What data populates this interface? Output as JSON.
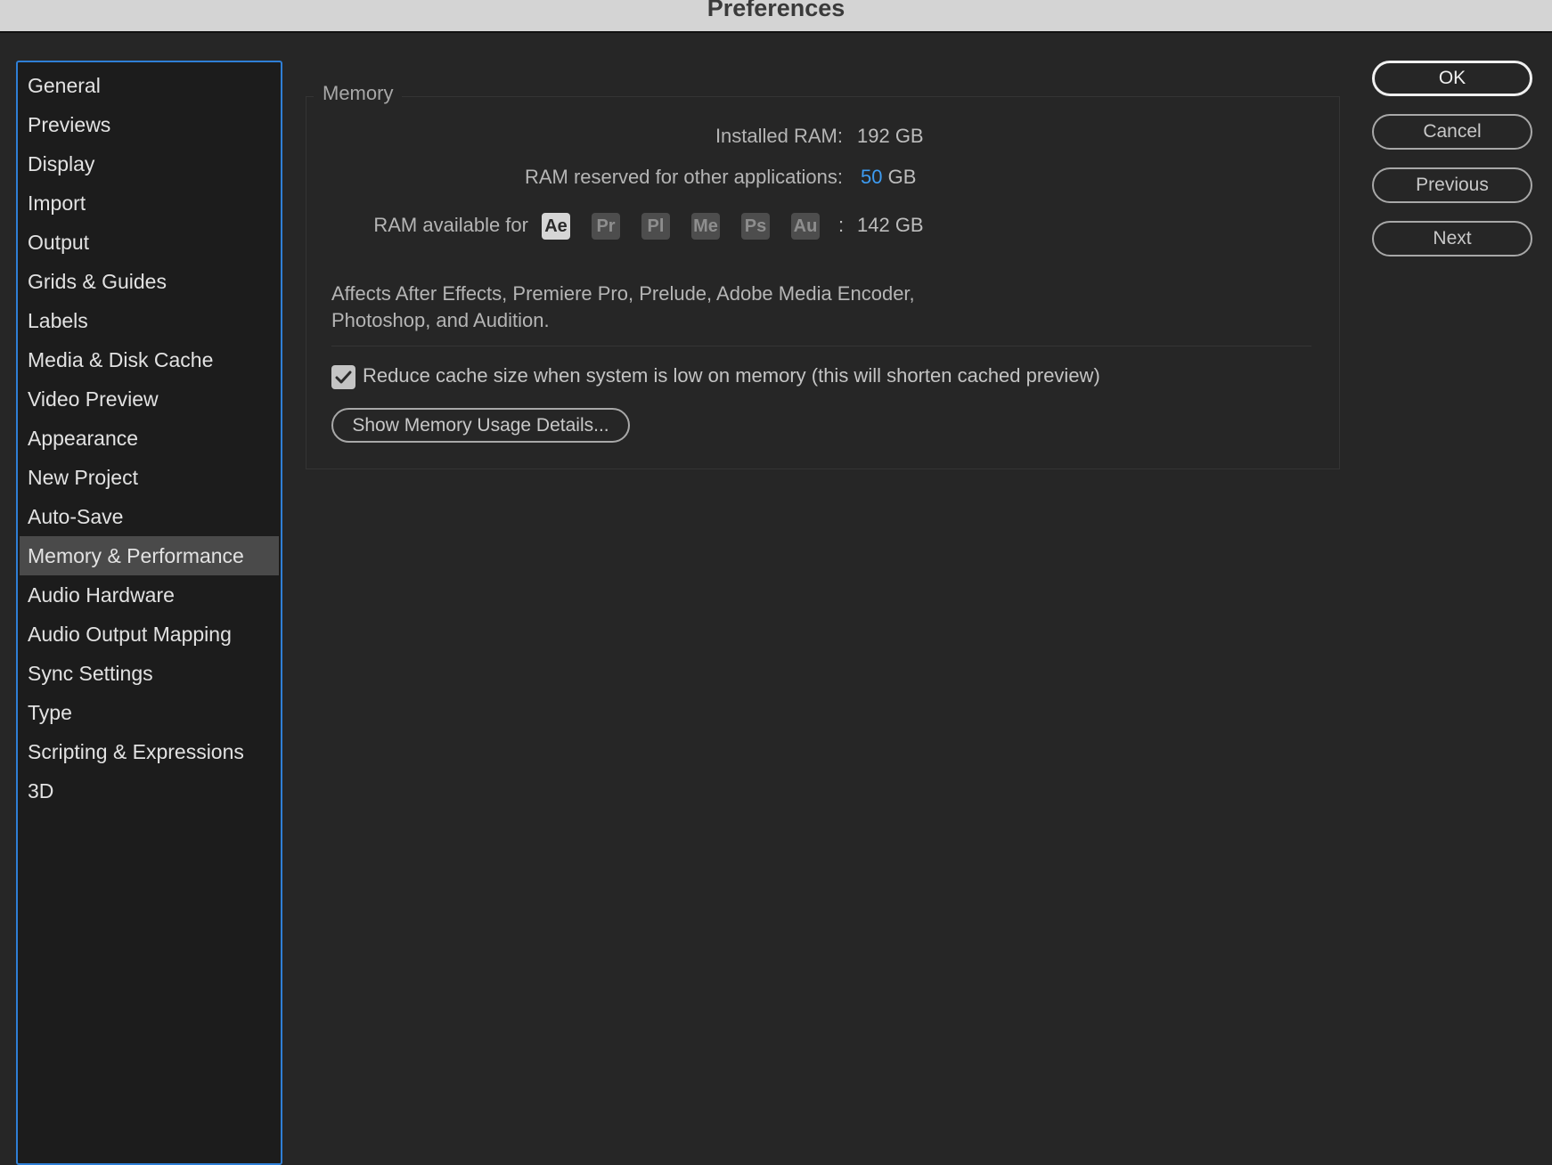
{
  "window": {
    "title": "Preferences"
  },
  "sidebar": {
    "items": [
      {
        "label": "General"
      },
      {
        "label": "Previews"
      },
      {
        "label": "Display"
      },
      {
        "label": "Import"
      },
      {
        "label": "Output"
      },
      {
        "label": "Grids & Guides"
      },
      {
        "label": "Labels"
      },
      {
        "label": "Media & Disk Cache"
      },
      {
        "label": "Video Preview"
      },
      {
        "label": "Appearance"
      },
      {
        "label": "New Project"
      },
      {
        "label": "Auto-Save"
      },
      {
        "label": "Memory & Performance"
      },
      {
        "label": "Audio Hardware"
      },
      {
        "label": "Audio Output Mapping"
      },
      {
        "label": "Sync Settings"
      },
      {
        "label": "Type"
      },
      {
        "label": "Scripting & Expressions"
      },
      {
        "label": "3D"
      }
    ],
    "selected_index": 12
  },
  "memory": {
    "group_label": "Memory",
    "installed_label": "Installed RAM:",
    "installed_value": "192 GB",
    "reserved_label": "RAM reserved for other applications:",
    "reserved_value": "50",
    "reserved_unit": "GB",
    "available_label": "RAM available for",
    "apps": [
      "Ae",
      "Pr",
      "Pl",
      "Me",
      "Ps",
      "Au"
    ],
    "available_sep": ":",
    "available_value": "142 GB",
    "description_line1": "Affects After Effects, Premiere Pro, Prelude, Adobe Media Encoder,",
    "description_line2": "Photoshop, and Audition.",
    "reduce_cache_label": "Reduce cache size when system is low on memory (this will shorten cached preview)",
    "reduce_cache_checked": true,
    "details_button": "Show Memory Usage Details..."
  },
  "dialog_buttons": {
    "ok": "OK",
    "cancel": "Cancel",
    "previous": "Previous",
    "next": "Next"
  },
  "colors": {
    "accent": "#3d9cf2",
    "sidebar_border": "#2f7fd6",
    "background": "#262626"
  }
}
